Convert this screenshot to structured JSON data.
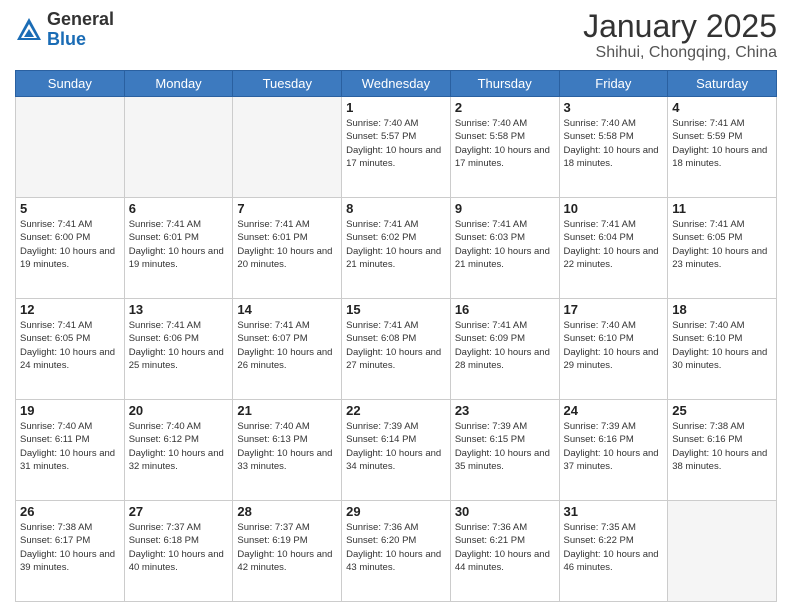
{
  "header": {
    "logo": {
      "general": "General",
      "blue": "Blue"
    },
    "title": "January 2025",
    "location": "Shihui, Chongqing, China"
  },
  "days_of_week": [
    "Sunday",
    "Monday",
    "Tuesday",
    "Wednesday",
    "Thursday",
    "Friday",
    "Saturday"
  ],
  "weeks": [
    [
      {
        "day": "",
        "sunrise": "",
        "sunset": "",
        "daylight": ""
      },
      {
        "day": "",
        "sunrise": "",
        "sunset": "",
        "daylight": ""
      },
      {
        "day": "",
        "sunrise": "",
        "sunset": "",
        "daylight": ""
      },
      {
        "day": "1",
        "sunrise": "Sunrise: 7:40 AM",
        "sunset": "Sunset: 5:57 PM",
        "daylight": "Daylight: 10 hours and 17 minutes."
      },
      {
        "day": "2",
        "sunrise": "Sunrise: 7:40 AM",
        "sunset": "Sunset: 5:58 PM",
        "daylight": "Daylight: 10 hours and 17 minutes."
      },
      {
        "day": "3",
        "sunrise": "Sunrise: 7:40 AM",
        "sunset": "Sunset: 5:58 PM",
        "daylight": "Daylight: 10 hours and 18 minutes."
      },
      {
        "day": "4",
        "sunrise": "Sunrise: 7:41 AM",
        "sunset": "Sunset: 5:59 PM",
        "daylight": "Daylight: 10 hours and 18 minutes."
      }
    ],
    [
      {
        "day": "5",
        "sunrise": "Sunrise: 7:41 AM",
        "sunset": "Sunset: 6:00 PM",
        "daylight": "Daylight: 10 hours and 19 minutes."
      },
      {
        "day": "6",
        "sunrise": "Sunrise: 7:41 AM",
        "sunset": "Sunset: 6:01 PM",
        "daylight": "Daylight: 10 hours and 19 minutes."
      },
      {
        "day": "7",
        "sunrise": "Sunrise: 7:41 AM",
        "sunset": "Sunset: 6:01 PM",
        "daylight": "Daylight: 10 hours and 20 minutes."
      },
      {
        "day": "8",
        "sunrise": "Sunrise: 7:41 AM",
        "sunset": "Sunset: 6:02 PM",
        "daylight": "Daylight: 10 hours and 21 minutes."
      },
      {
        "day": "9",
        "sunrise": "Sunrise: 7:41 AM",
        "sunset": "Sunset: 6:03 PM",
        "daylight": "Daylight: 10 hours and 21 minutes."
      },
      {
        "day": "10",
        "sunrise": "Sunrise: 7:41 AM",
        "sunset": "Sunset: 6:04 PM",
        "daylight": "Daylight: 10 hours and 22 minutes."
      },
      {
        "day": "11",
        "sunrise": "Sunrise: 7:41 AM",
        "sunset": "Sunset: 6:05 PM",
        "daylight": "Daylight: 10 hours and 23 minutes."
      }
    ],
    [
      {
        "day": "12",
        "sunrise": "Sunrise: 7:41 AM",
        "sunset": "Sunset: 6:05 PM",
        "daylight": "Daylight: 10 hours and 24 minutes."
      },
      {
        "day": "13",
        "sunrise": "Sunrise: 7:41 AM",
        "sunset": "Sunset: 6:06 PM",
        "daylight": "Daylight: 10 hours and 25 minutes."
      },
      {
        "day": "14",
        "sunrise": "Sunrise: 7:41 AM",
        "sunset": "Sunset: 6:07 PM",
        "daylight": "Daylight: 10 hours and 26 minutes."
      },
      {
        "day": "15",
        "sunrise": "Sunrise: 7:41 AM",
        "sunset": "Sunset: 6:08 PM",
        "daylight": "Daylight: 10 hours and 27 minutes."
      },
      {
        "day": "16",
        "sunrise": "Sunrise: 7:41 AM",
        "sunset": "Sunset: 6:09 PM",
        "daylight": "Daylight: 10 hours and 28 minutes."
      },
      {
        "day": "17",
        "sunrise": "Sunrise: 7:40 AM",
        "sunset": "Sunset: 6:10 PM",
        "daylight": "Daylight: 10 hours and 29 minutes."
      },
      {
        "day": "18",
        "sunrise": "Sunrise: 7:40 AM",
        "sunset": "Sunset: 6:10 PM",
        "daylight": "Daylight: 10 hours and 30 minutes."
      }
    ],
    [
      {
        "day": "19",
        "sunrise": "Sunrise: 7:40 AM",
        "sunset": "Sunset: 6:11 PM",
        "daylight": "Daylight: 10 hours and 31 minutes."
      },
      {
        "day": "20",
        "sunrise": "Sunrise: 7:40 AM",
        "sunset": "Sunset: 6:12 PM",
        "daylight": "Daylight: 10 hours and 32 minutes."
      },
      {
        "day": "21",
        "sunrise": "Sunrise: 7:40 AM",
        "sunset": "Sunset: 6:13 PM",
        "daylight": "Daylight: 10 hours and 33 minutes."
      },
      {
        "day": "22",
        "sunrise": "Sunrise: 7:39 AM",
        "sunset": "Sunset: 6:14 PM",
        "daylight": "Daylight: 10 hours and 34 minutes."
      },
      {
        "day": "23",
        "sunrise": "Sunrise: 7:39 AM",
        "sunset": "Sunset: 6:15 PM",
        "daylight": "Daylight: 10 hours and 35 minutes."
      },
      {
        "day": "24",
        "sunrise": "Sunrise: 7:39 AM",
        "sunset": "Sunset: 6:16 PM",
        "daylight": "Daylight: 10 hours and 37 minutes."
      },
      {
        "day": "25",
        "sunrise": "Sunrise: 7:38 AM",
        "sunset": "Sunset: 6:16 PM",
        "daylight": "Daylight: 10 hours and 38 minutes."
      }
    ],
    [
      {
        "day": "26",
        "sunrise": "Sunrise: 7:38 AM",
        "sunset": "Sunset: 6:17 PM",
        "daylight": "Daylight: 10 hours and 39 minutes."
      },
      {
        "day": "27",
        "sunrise": "Sunrise: 7:37 AM",
        "sunset": "Sunset: 6:18 PM",
        "daylight": "Daylight: 10 hours and 40 minutes."
      },
      {
        "day": "28",
        "sunrise": "Sunrise: 7:37 AM",
        "sunset": "Sunset: 6:19 PM",
        "daylight": "Daylight: 10 hours and 42 minutes."
      },
      {
        "day": "29",
        "sunrise": "Sunrise: 7:36 AM",
        "sunset": "Sunset: 6:20 PM",
        "daylight": "Daylight: 10 hours and 43 minutes."
      },
      {
        "day": "30",
        "sunrise": "Sunrise: 7:36 AM",
        "sunset": "Sunset: 6:21 PM",
        "daylight": "Daylight: 10 hours and 44 minutes."
      },
      {
        "day": "31",
        "sunrise": "Sunrise: 7:35 AM",
        "sunset": "Sunset: 6:22 PM",
        "daylight": "Daylight: 10 hours and 46 minutes."
      },
      {
        "day": "",
        "sunrise": "",
        "sunset": "",
        "daylight": ""
      }
    ]
  ]
}
